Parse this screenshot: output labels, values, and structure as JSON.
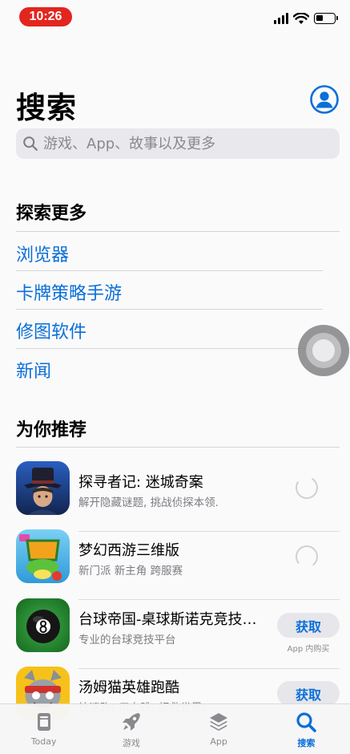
{
  "status_bar": {
    "time": "10:26"
  },
  "header": {
    "title": "搜索",
    "search_placeholder": "游戏、App、故事以及更多"
  },
  "explore": {
    "title": "探索更多",
    "items": [
      "浏览器",
      "卡牌策略手游",
      "修图软件",
      "新闻"
    ]
  },
  "recommended": {
    "title": "为你推荐",
    "apps": [
      {
        "name": "探寻者记: 迷城奇案",
        "subtitle": "解开隐藏谜题, 挑战侦探本领.",
        "state": "loading"
      },
      {
        "name": "梦幻西游三维版",
        "subtitle": "新门派 新主角 跨服赛",
        "state": "loading"
      },
      {
        "name": "台球帝国-桌球斯诺克竞技…",
        "subtitle": "专业的台球竞技平台",
        "action": "获取",
        "note": "App 内购买"
      },
      {
        "name": "汤姆猫英雄跑酷",
        "subtitle": "快速跑! 用力跳! 拯救世界!",
        "action": "获取"
      }
    ]
  },
  "tabs": [
    {
      "label": "Today",
      "icon": "today-icon"
    },
    {
      "label": "游戏",
      "icon": "rocket-icon"
    },
    {
      "label": "App",
      "icon": "app-stack-icon"
    },
    {
      "label": "搜索",
      "icon": "search-icon",
      "active": true
    }
  ],
  "colors": {
    "accent": "#0a6fd8",
    "time_pill": "#e2261e"
  }
}
